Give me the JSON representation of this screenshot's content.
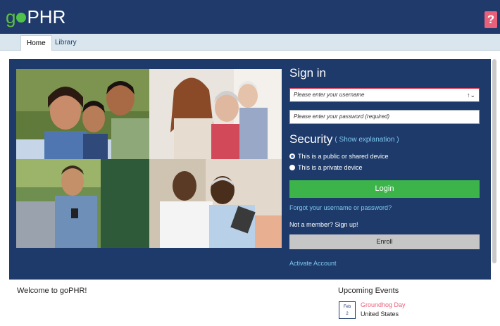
{
  "header": {
    "logo_prefix": "g",
    "logo_suffix": "PHR",
    "help_label": "?"
  },
  "tabs": [
    {
      "label": "Home",
      "active": true
    },
    {
      "label": "Library",
      "active": false
    }
  ],
  "signin": {
    "title": "Sign in",
    "username_placeholder": "Please enter your username",
    "username_ctrl": "↑⌄",
    "password_placeholder": "Please enter your password (required)",
    "security_title": "Security",
    "show_explanation": "( Show explanation )",
    "option_public": "This is a public or shared device",
    "option_private": "This is a private device",
    "selected_option": "public",
    "login_label": "Login",
    "forgot_link": "Forgot your username or password?",
    "not_member": "Not a member? Sign up!",
    "enroll_label": "Enroll",
    "activate_link": "Activate Account"
  },
  "welcome": "Welcome to goPHR!",
  "events": {
    "title": "Upcoming Events",
    "items": [
      {
        "month": "Feb",
        "day": "2",
        "name": "Groundhog Day",
        "location": "United States"
      }
    ]
  },
  "colors": {
    "brand_navy": "#1f3a6b",
    "accent_green": "#3cb44a",
    "link_blue": "#7fc8f0",
    "help_pink": "#e8607a"
  }
}
